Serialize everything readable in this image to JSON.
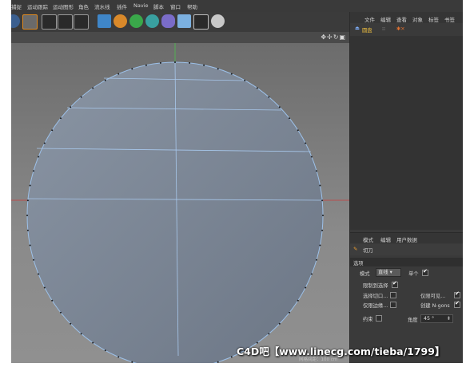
{
  "menu": [
    "捕捉",
    "运动跟踪",
    "运动图形",
    "角色",
    "流水线",
    "插件",
    "Navie",
    "脚本",
    "窗口",
    "帮助"
  ],
  "right_tabs": [
    "文件",
    "编辑",
    "查看",
    "对象",
    "标签",
    "书签"
  ],
  "object_name": "圆盘",
  "attr_tabs": [
    "模式",
    "编辑",
    "用户数据"
  ],
  "tool_name": "切刀",
  "section": "选项",
  "mode_label": "模式",
  "mode_value": "直线",
  "single_label": "单个",
  "restrict_label": "限制到选择",
  "visible_only_label": "仅限可见...",
  "select_cut_label": "选择切口...",
  "create_ngons_label": "创建 N-gons",
  "edges_only_label": "仅限边缘...",
  "constrain_label": "约束",
  "angle_label": "角度",
  "angle_value": "45 °",
  "status": "网格间距：100 cm",
  "watermark": "C4D吧【www.linecg.com/tieba/1799】",
  "colors": {
    "accent": "#f0c040",
    "selection": "#7fa7d8",
    "axis_red": "#c83c3c",
    "axis_green": "#4cc04c"
  }
}
